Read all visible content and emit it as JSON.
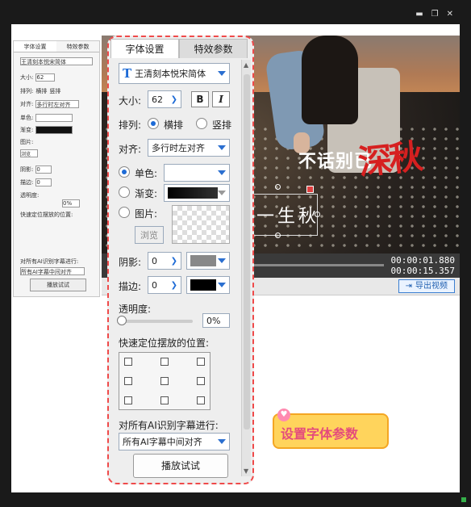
{
  "mini_panel": {
    "tab_font": "字体设置",
    "tab_effects": "特效参数",
    "font_name": "王清刻本悦宋简体",
    "size_label": "大小:",
    "size_value": "62",
    "layout_label": "排列:",
    "horizontal": "横排",
    "vertical": "竖排",
    "align_label": "对齐:",
    "align_value": "多行时左对齐",
    "solid_label": "单色:",
    "gradient_label": "渐变:",
    "image_label": "图片:",
    "browse": "浏览",
    "shadow_label": "阴影:",
    "shadow_value": "0",
    "outline_label": "描边:",
    "outline_value": "0",
    "opacity_label": "透明度:",
    "opacity_value": "0%",
    "position_label": "快速定位摆放的位置:",
    "ai_label": "对所有AI识别字幕进行:",
    "ai_value": "所有AI字幕中间对齐",
    "play": "播放试试"
  },
  "video": {
    "caption1": "不话别已",
    "caption2": "深秋",
    "caption3": "一生秋",
    "time_current": "00:00:01.880",
    "time_total": "00:00:15.357",
    "export_label": "导出视频"
  },
  "panel": {
    "tab_font": "字体设置",
    "tab_effects": "特效参数",
    "font_name": "王清刻本悦宋简体",
    "size_label": "大小:",
    "size_value": "62",
    "bold": "B",
    "italic": "I",
    "layout_label": "排列:",
    "horizontal": "横排",
    "vertical": "竖排",
    "align_label": "对齐:",
    "align_value": "多行时左对齐",
    "solid_label": "单色:",
    "gradient_label": "渐变:",
    "image_label": "图片:",
    "browse": "浏览",
    "shadow_label": "阴影:",
    "shadow_value": "0",
    "outline_label": "描边:",
    "outline_value": "0",
    "opacity_label": "透明度:",
    "opacity_value": "0%",
    "position_label": "快速定位摆放的位置:",
    "ai_label": "对所有AI识别字幕进行:",
    "ai_value": "所有AI字幕中间对齐",
    "play": "播放试试"
  },
  "badge": {
    "text": "设置字体参数"
  },
  "colors": {
    "accent": "#1e6bd6",
    "dash": "#ef4a4a",
    "caption_red": "#d62020",
    "badge_bg": "#ffd45c"
  }
}
